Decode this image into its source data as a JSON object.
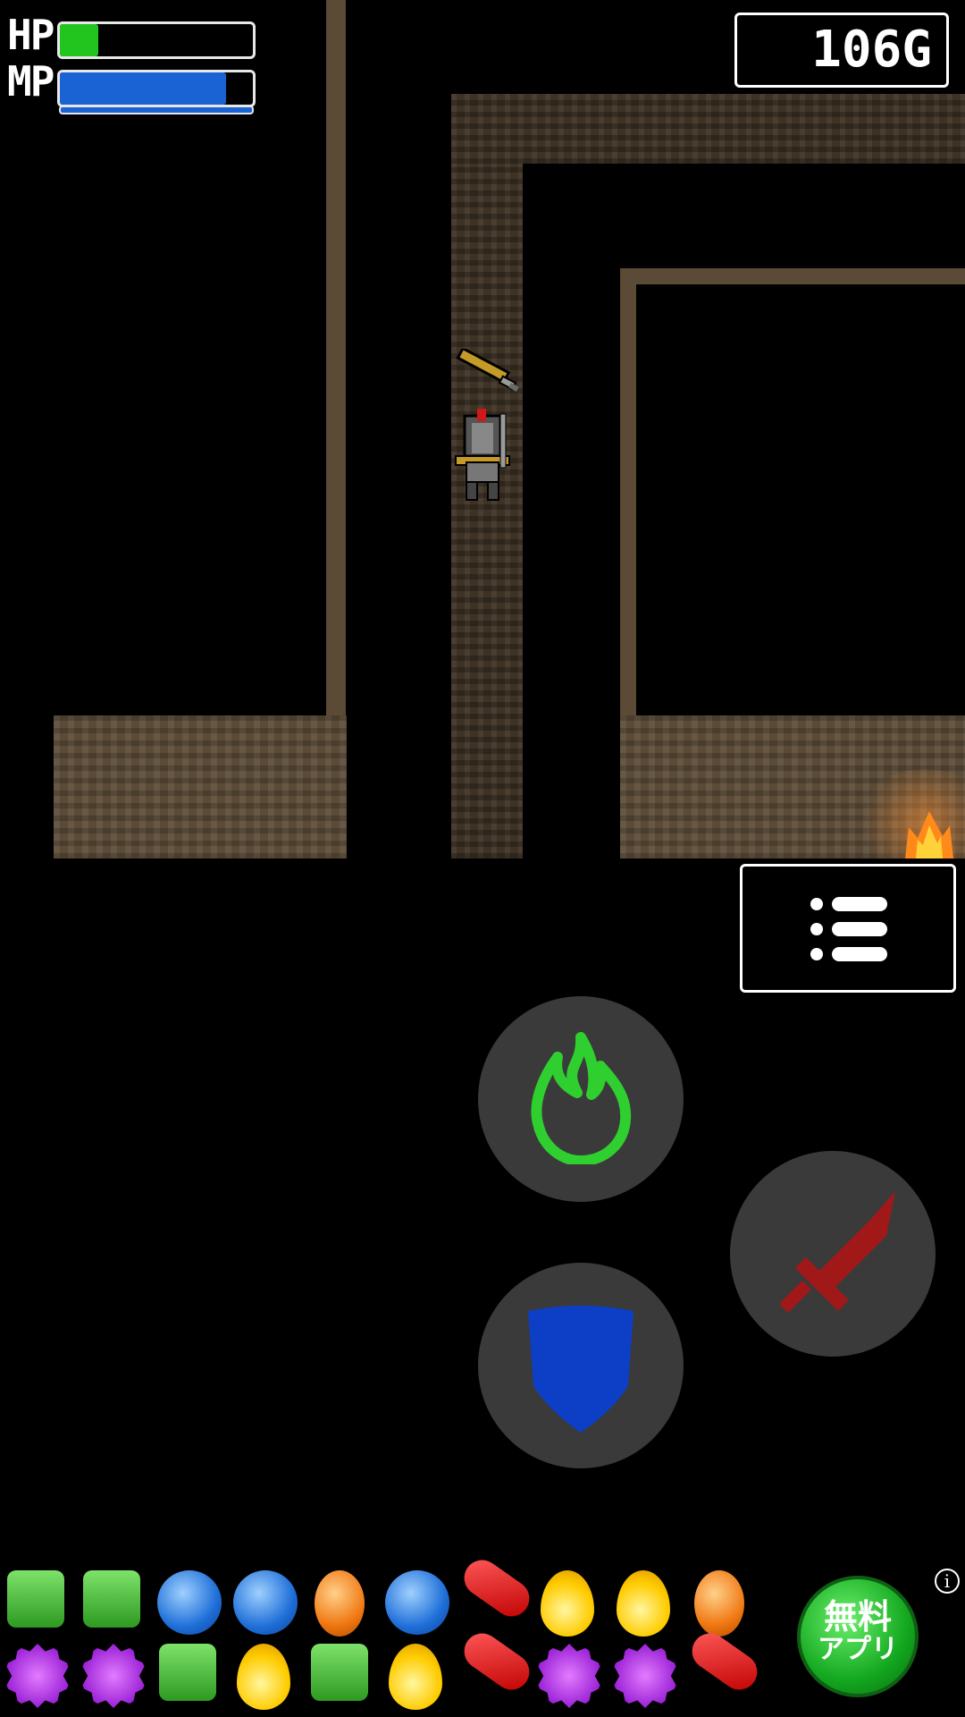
{
  "hud": {
    "hp_label": "HP",
    "mp_label": "MP",
    "hp_fraction": 0.2,
    "mp_fraction": 0.86,
    "gold": "106G",
    "hp_color": "#22c41e",
    "mp_color": "#1a63d4"
  },
  "map": {
    "floor_color": "#5a4a36",
    "player": "armored-knight",
    "items": [
      "sword-on-ground",
      "campfire"
    ]
  },
  "controls": {
    "menu_icon": "list-icon",
    "magic_icon": "green-flame-icon",
    "attack_icon": "red-sword-icon",
    "defend_icon": "blue-shield-icon"
  },
  "ad": {
    "button_line1": "無料",
    "button_line2": "アプリ",
    "info_label": "i",
    "candy_row1": [
      "green",
      "green",
      "blue",
      "blue",
      "orange",
      "blue",
      "red",
      "yellow",
      "yellow",
      "orange"
    ],
    "candy_row2": [
      "purple",
      "purple",
      "green",
      "yellow",
      "green",
      "yellow",
      "red",
      "purple",
      "purple",
      "red"
    ]
  }
}
